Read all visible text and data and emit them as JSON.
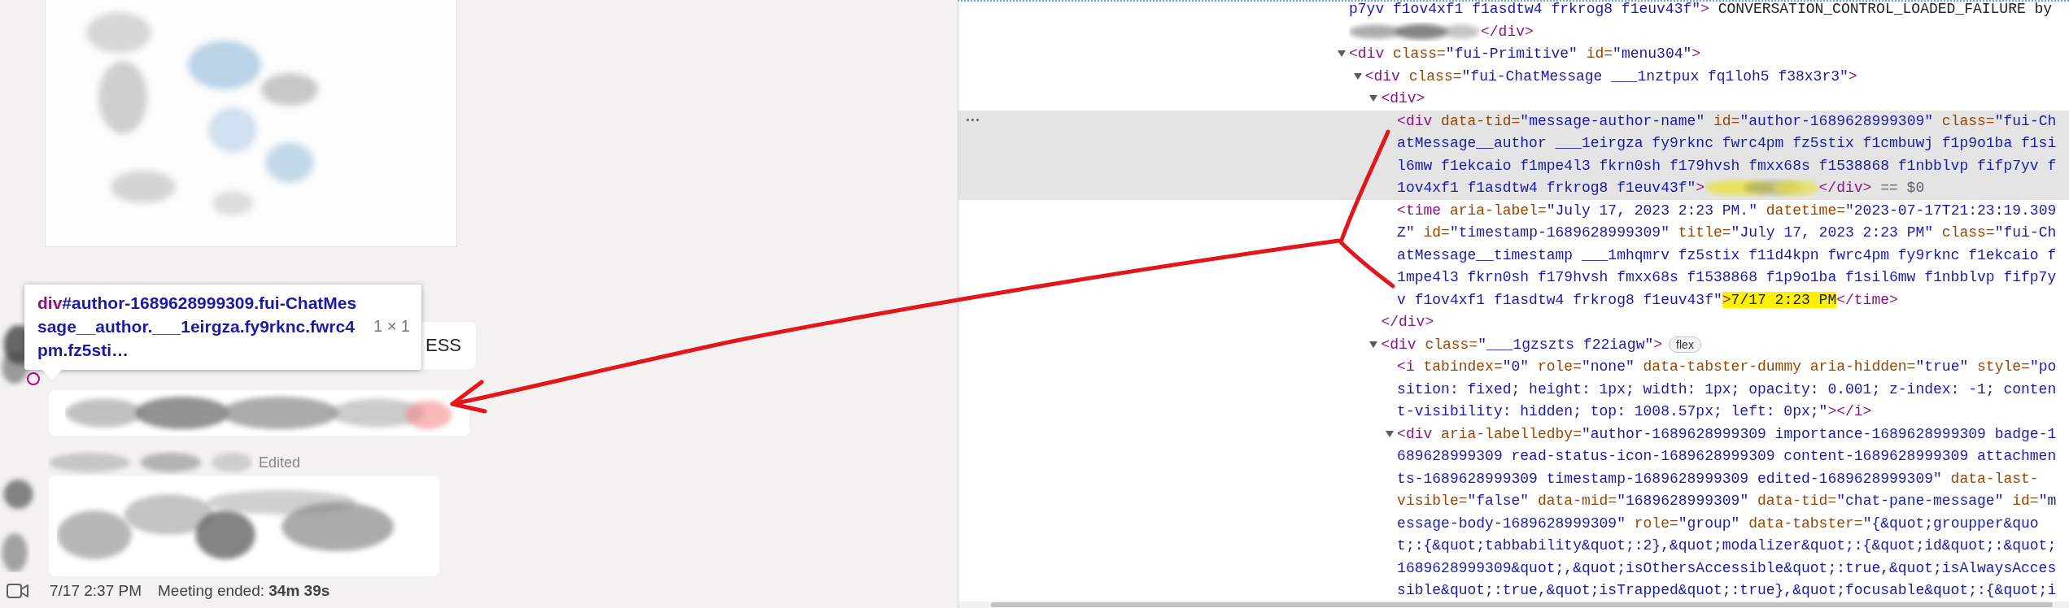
{
  "chat": {
    "tooltip": {
      "tag": "div",
      "selector": "#author-1689628999309.fui-ChatMessage__author.___1eirgza.fy9rknc.fwrc4pm.fz5sti…",
      "size": "1 × 1"
    },
    "bubble_text": "ESS",
    "edited_label": "Edited",
    "meeting": {
      "time": "7/17 2:37 PM",
      "summary": "Meeting ended: **34m 39s**"
    }
  },
  "devtools": {
    "nodes": [
      {
        "selected": false,
        "lines": [
          [
            {
              "kind": "attr-value",
              "text": "p7yv f1ov4xf1 f1asdtw4 frkrog8 f1euv43f\""
            },
            {
              "kind": "tag",
              "text": ">"
            },
            {
              "kind": "text",
              "text": " CONVERSATION_CONTROL_LOADED_FAILURE by"
            }
          ],
          [
            {
              "kind": "redacted"
            },
            {
              "kind": "tag",
              "text": "</div>"
            }
          ]
        ]
      },
      {
        "selected": false,
        "expanded": true,
        "lines": [
          [
            {
              "kind": "tag",
              "text": "<div"
            },
            {
              "kind": "attr-name",
              "text": " class="
            },
            {
              "kind": "attr-value",
              "text": "\"fui-Primitive\""
            },
            {
              "kind": "attr-name",
              "text": " id="
            },
            {
              "kind": "attr-value",
              "text": "\"menu304\""
            },
            {
              "kind": "tag",
              "text": ">"
            }
          ]
        ],
        "children": [
          {
            "selected": false,
            "expanded": true,
            "lines": [
              [
                {
                  "kind": "tag",
                  "text": "<div"
                },
                {
                  "kind": "attr-name",
                  "text": " class="
                },
                {
                  "kind": "attr-value",
                  "text": "\"fui-ChatMessage ___1nztpux fq1loh5 f38x3r3\""
                },
                {
                  "kind": "tag",
                  "text": ">"
                }
              ]
            ],
            "children": [
              {
                "selected": false,
                "expanded": true,
                "lines": [
                  [
                    {
                      "kind": "tag",
                      "text": "<div>"
                    }
                  ]
                ],
                "closing": [
                  {
                    "kind": "tag",
                    "text": "</div>"
                  }
                ],
                "children": [
                  {
                    "selected": true,
                    "lines": [
                      [
                        {
                          "kind": "tag",
                          "text": "<div"
                        },
                        {
                          "kind": "attr-name",
                          "text": " data-tid="
                        },
                        {
                          "kind": "attr-value",
                          "text": "\"message-author-name\""
                        },
                        {
                          "kind": "attr-name",
                          "text": " id="
                        },
                        {
                          "kind": "attr-value",
                          "text": "\"author-1689628999309\""
                        },
                        {
                          "kind": "attr-name",
                          "text": " class="
                        },
                        {
                          "kind": "attr-value",
                          "text": "\"fui-Ch"
                        }
                      ],
                      [
                        {
                          "kind": "attr-value",
                          "text": "atMessage__author ___1eirgza fy9rknc fwrc4pm fz5stix f1cmbuwj f1p9o1ba f1si"
                        }
                      ],
                      [
                        {
                          "kind": "attr-value",
                          "text": "l6mw f1ekcaio f1mpe4l3 fkrn0sh f179hvsh fmxx68s f1538868 f1nbblvp fifp7yv f"
                        }
                      ],
                      [
                        {
                          "kind": "attr-value",
                          "text": "1ov4xf1 f1asdtw4 frkrog8 f1euv43f\""
                        },
                        {
                          "kind": "tag",
                          "text": ">"
                        },
                        {
                          "kind": "redacted-highlight"
                        },
                        {
                          "kind": "tag",
                          "text": "</div>"
                        },
                        {
                          "kind": "console-ref",
                          "text": " == $0"
                        }
                      ]
                    ]
                  },
                  {
                    "selected": false,
                    "lines": [
                      [
                        {
                          "kind": "tag",
                          "text": "<time"
                        },
                        {
                          "kind": "attr-name",
                          "text": " aria-label="
                        },
                        {
                          "kind": "attr-value",
                          "text": "\"July 17, 2023 2:23 PM.\""
                        },
                        {
                          "kind": "attr-name",
                          "text": " datetime="
                        },
                        {
                          "kind": "attr-value",
                          "text": "\"2023-07-17T21:23:19.309"
                        }
                      ],
                      [
                        {
                          "kind": "attr-value",
                          "text": "Z\""
                        },
                        {
                          "kind": "attr-name",
                          "text": " id="
                        },
                        {
                          "kind": "attr-value",
                          "text": "\"timestamp-1689628999309\""
                        },
                        {
                          "kind": "attr-name",
                          "text": " title="
                        },
                        {
                          "kind": "attr-value",
                          "text": "\"July 17, 2023 2:23 PM\""
                        },
                        {
                          "kind": "attr-name",
                          "text": " class="
                        },
                        {
                          "kind": "attr-value",
                          "text": "\"fui-Ch"
                        }
                      ],
                      [
                        {
                          "kind": "attr-value",
                          "text": "atMessage__timestamp ___1mhqmrv fz5stix f11d4kpn fwrc4pm fy9rknc f1ekcaio f"
                        }
                      ],
                      [
                        {
                          "kind": "attr-value",
                          "text": "1mpe4l3 fkrn0sh f179hvsh fmxx68s f1538868 f1p9o1ba f1sil6mw f1nbblvp fifp7y"
                        }
                      ],
                      [
                        {
                          "kind": "attr-value",
                          "text": "v f1ov4xf1 f1asdtw4 frkrog8 f1euv43f\""
                        },
                        {
                          "kind": "highlight-tag",
                          "text": ">"
                        },
                        {
                          "kind": "highlight-text",
                          "text": "7/17 2:23 PM"
                        },
                        {
                          "kind": "tag",
                          "text": "</time>"
                        }
                      ]
                    ]
                  }
                ]
              },
              {
                "selected": false,
                "expanded": true,
                "lines": [
                  [
                    {
                      "kind": "tag",
                      "text": "<div"
                    },
                    {
                      "kind": "attr-name",
                      "text": " class="
                    },
                    {
                      "kind": "attr-value",
                      "text": "\"___1gzszts f22iagw\""
                    },
                    {
                      "kind": "tag",
                      "text": ">"
                    },
                    {
                      "kind": "badge",
                      "text": "flex"
                    }
                  ]
                ],
                "children": [
                  {
                    "selected": false,
                    "lines": [
                      [
                        {
                          "kind": "tag",
                          "text": "<i"
                        },
                        {
                          "kind": "attr-name",
                          "text": " tabindex="
                        },
                        {
                          "kind": "attr-value",
                          "text": "\"0\""
                        },
                        {
                          "kind": "attr-name",
                          "text": " role="
                        },
                        {
                          "kind": "attr-value",
                          "text": "\"none\""
                        },
                        {
                          "kind": "attr-name",
                          "text": " data-tabster-dummy"
                        },
                        {
                          "kind": "attr-name",
                          "text": " aria-hidden="
                        },
                        {
                          "kind": "attr-value",
                          "text": "\"true\""
                        },
                        {
                          "kind": "attr-name",
                          "text": " style="
                        },
                        {
                          "kind": "attr-value",
                          "text": "\"po"
                        }
                      ],
                      [
                        {
                          "kind": "attr-value",
                          "text": "sition: fixed; height: 1px; width: 1px; opacity: 0.001; z-index: -1; conten"
                        }
                      ],
                      [
                        {
                          "kind": "attr-value",
                          "text": "t-visibility: hidden; top: 1008.57px; left: 0px;\""
                        },
                        {
                          "kind": "tag",
                          "text": "></i>"
                        }
                      ]
                    ]
                  },
                  {
                    "selected": false,
                    "expanded": true,
                    "lines": [
                      [
                        {
                          "kind": "tag",
                          "text": "<div"
                        },
                        {
                          "kind": "attr-name",
                          "text": " aria-labelledby="
                        },
                        {
                          "kind": "attr-value",
                          "text": "\"author-1689628999309 importance-1689628999309 badge-1"
                        }
                      ],
                      [
                        {
                          "kind": "attr-value",
                          "text": "689628999309 read-status-icon-1689628999309 content-1689628999309 attachmen"
                        }
                      ],
                      [
                        {
                          "kind": "attr-value",
                          "text": "ts-1689628999309 timestamp-1689628999309 edited-1689628999309\""
                        },
                        {
                          "kind": "attr-name",
                          "text": " data-last-"
                        }
                      ],
                      [
                        {
                          "kind": "attr-name",
                          "text": "visible="
                        },
                        {
                          "kind": "attr-value",
                          "text": "\"false\""
                        },
                        {
                          "kind": "attr-name",
                          "text": " data-mid="
                        },
                        {
                          "kind": "attr-value",
                          "text": "\"1689628999309\""
                        },
                        {
                          "kind": "attr-name",
                          "text": " data-tid="
                        },
                        {
                          "kind": "attr-value",
                          "text": "\"chat-pane-message\""
                        },
                        {
                          "kind": "attr-name",
                          "text": " id="
                        },
                        {
                          "kind": "attr-value",
                          "text": "\"m"
                        }
                      ],
                      [
                        {
                          "kind": "attr-value",
                          "text": "essage-body-1689628999309\""
                        },
                        {
                          "kind": "attr-name",
                          "text": " role="
                        },
                        {
                          "kind": "attr-value",
                          "text": "\"group\""
                        },
                        {
                          "kind": "attr-name",
                          "text": " data-tabster="
                        },
                        {
                          "kind": "attr-value",
                          "text": "\"{&quot;groupper&quo"
                        }
                      ],
                      [
                        {
                          "kind": "attr-value",
                          "text": "t;:{&quot;tabbability&quot;:2},&quot;modalizer&quot;:{&quot;id&quot;:&quot;"
                        }
                      ],
                      [
                        {
                          "kind": "attr-value",
                          "text": "1689628999309&quot;,&quot;isOthersAccessible&quot;:true,&quot;isAlwaysAcces"
                        }
                      ],
                      [
                        {
                          "kind": "attr-value",
                          "text": "sible&quot;:true,&quot;isTrapped&quot;:true},&quot;focusable&quot;:{&quot;i"
                        }
                      ]
                    ]
                  }
                ]
              }
            ]
          }
        ]
      }
    ]
  }
}
